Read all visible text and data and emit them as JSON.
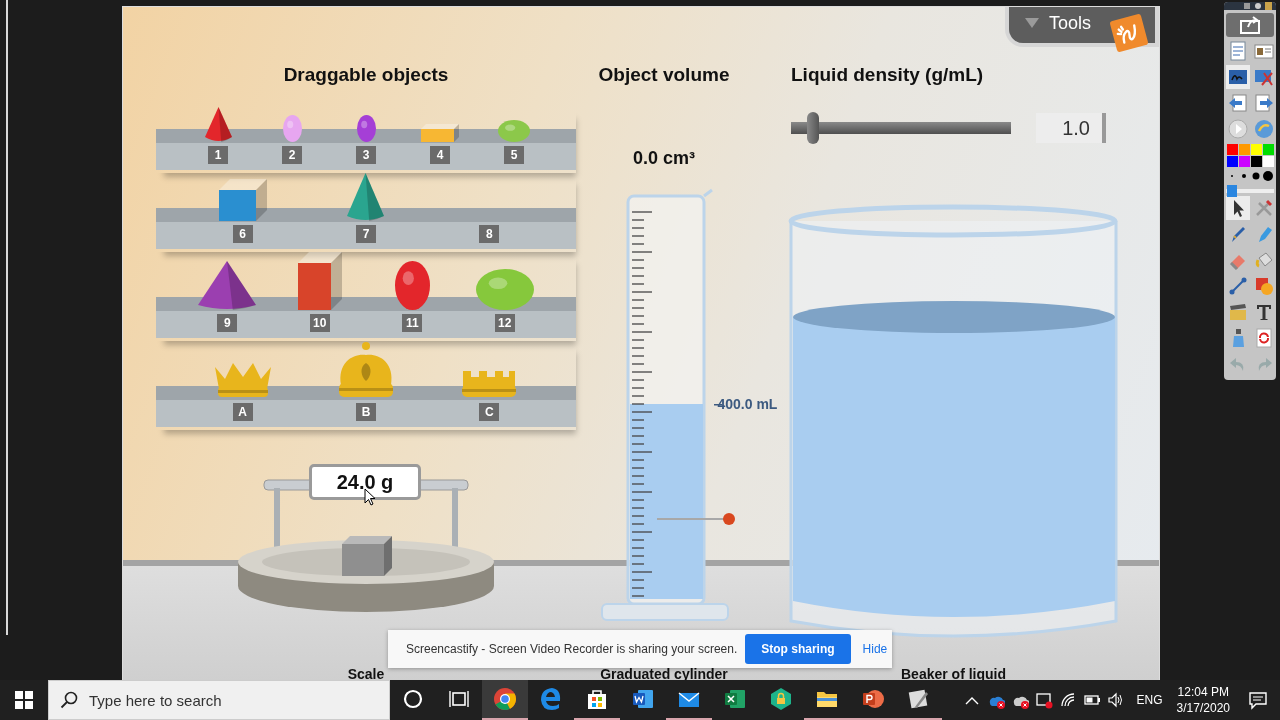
{
  "sim": {
    "tools_tab": {
      "label": "Tools"
    },
    "objects": {
      "title": "Draggable objects",
      "shelves": [
        {
          "items": [
            {
              "label": "1",
              "kind": "cone",
              "color": "#e3262b"
            },
            {
              "label": "2",
              "kind": "egg",
              "color": "#e7a6f0"
            },
            {
              "label": "3",
              "kind": "egg",
              "color": "#a53fd6"
            },
            {
              "label": "4",
              "kind": "slab",
              "color": "#f7b733"
            },
            {
              "label": "5",
              "kind": "lump",
              "color": "#8cc84a"
            }
          ]
        },
        {
          "items": [
            {
              "label": "6",
              "kind": "cube",
              "color": "#2a8fd0"
            },
            {
              "label": "7",
              "kind": "cone",
              "color": "#2aa58f"
            },
            {
              "label": "8",
              "kind": "none"
            }
          ]
        },
        {
          "items": [
            {
              "label": "9",
              "kind": "pyramid",
              "color": "#9b3fb0"
            },
            {
              "label": "10",
              "kind": "prism",
              "color": "#d8442a"
            },
            {
              "label": "11",
              "kind": "egg",
              "color": "#e3262b"
            },
            {
              "label": "12",
              "kind": "lump",
              "color": "#86c83c"
            }
          ]
        },
        {
          "items": [
            {
              "label": "A",
              "kind": "crown-spiked",
              "color": "#e8b51c"
            },
            {
              "label": "B",
              "kind": "crown-domed",
              "color": "#e8b51c"
            },
            {
              "label": "C",
              "kind": "crown-flat",
              "color": "#e8b51c"
            }
          ]
        }
      ]
    },
    "scale": {
      "reading": "24.0 g",
      "caption": "Scale"
    },
    "cylinder": {
      "title": "Object volume",
      "reading": "0.0 cm³",
      "level": 0.5,
      "level_reading": "400.0 mL",
      "caption": "Graduated cylinder"
    },
    "density": {
      "title": "Liquid density (g/mL)",
      "level": 0.08,
      "value": "1.0"
    },
    "beaker": {
      "level": 0.76,
      "caption": "Beaker of liquid"
    }
  },
  "share_bar": {
    "message": "Screencastify - Screen Video Recorder is sharing your screen.",
    "stop_button": "Stop sharing",
    "hide_link": "Hide"
  },
  "palette": {
    "tools": [
      {
        "kind": "export",
        "selected": false
      },
      {
        "kind": "doc-list",
        "selected": false
      },
      {
        "kind": "id-card",
        "selected": false
      },
      {
        "kind": "ink",
        "selected": true
      },
      {
        "kind": "screen-tools",
        "selected": false
      },
      {
        "kind": "page-prev",
        "selected": false
      },
      {
        "kind": "page-next",
        "selected": false
      },
      {
        "kind": "play",
        "selected": false
      },
      {
        "kind": "globe",
        "selected": false
      }
    ],
    "colors": [
      {
        "color": "#ff0000"
      },
      {
        "color": "#ff9900"
      },
      {
        "color": "#ffff00"
      },
      {
        "color": "#00dd00"
      },
      {
        "color": "#0000ff"
      },
      {
        "color": "#cc00ff"
      },
      {
        "color": "#000000"
      },
      {
        "color": "#ffffff"
      }
    ],
    "thickness": {
      "level": 0.12
    },
    "draw_tools": [
      {
        "kind": "pointer",
        "selected": true
      },
      {
        "kind": "tools",
        "selected": false
      },
      {
        "kind": "pen",
        "selected": false
      },
      {
        "kind": "highlighter",
        "selected": false
      },
      {
        "kind": "eraser",
        "selected": false
      },
      {
        "kind": "bucket",
        "selected": false
      },
      {
        "kind": "line",
        "selected": false
      },
      {
        "kind": "shapes",
        "selected": false
      },
      {
        "kind": "clapper",
        "selected": false
      },
      {
        "kind": "text",
        "selected": false
      },
      {
        "kind": "spray",
        "selected": false
      },
      {
        "kind": "refresh",
        "selected": false
      },
      {
        "kind": "undo",
        "selected": false
      },
      {
        "kind": "redo",
        "selected": false
      }
    ]
  },
  "taskbar": {
    "search": {
      "placeholder": "Type here to search"
    },
    "apps": [
      {
        "kind": "cortana",
        "selected": false,
        "running": false
      },
      {
        "kind": "task-view",
        "selected": false,
        "running": false
      },
      {
        "kind": "chrome",
        "selected": true,
        "running": true
      },
      {
        "kind": "edge",
        "selected": false,
        "running": false
      },
      {
        "kind": "store",
        "selected": false,
        "running": true
      },
      {
        "kind": "word",
        "selected": false,
        "running": false
      },
      {
        "kind": "mail",
        "selected": false,
        "running": true
      },
      {
        "kind": "excel",
        "selected": false,
        "running": false
      },
      {
        "kind": "vpn",
        "selected": false,
        "running": false
      },
      {
        "kind": "explorer",
        "selected": false,
        "running": true
      },
      {
        "kind": "powerpoint",
        "selected": false,
        "running": true
      },
      {
        "kind": "tool-app",
        "selected": false,
        "running": true
      }
    ],
    "tray": {
      "language": "ENG",
      "time": "12:04 PM",
      "date": "3/17/2020"
    }
  }
}
